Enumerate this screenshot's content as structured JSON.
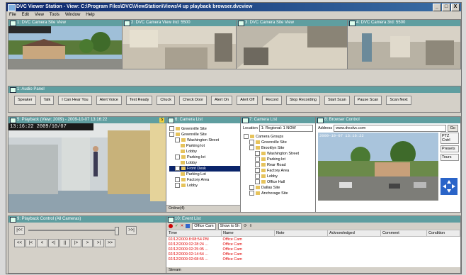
{
  "window": {
    "title": "DVC Viewer Station - View: C:\\Program Files\\DVC\\ViewStation\\Views\\4 up playback browser.dvcview",
    "controls": [
      "_",
      "□",
      "X"
    ]
  },
  "menu": [
    "File",
    "Edit",
    "View",
    "Tools",
    "Window",
    "Help"
  ],
  "cameras": [
    {
      "title": "1: DVC Camera Site View",
      "overlay": ""
    },
    {
      "title": "2: DVC Camera View Ind: 5500",
      "overlay": ""
    },
    {
      "title": "3: DVC Camera Site View",
      "overlay": ""
    },
    {
      "title": "4: DVC Camera 3rd: 5500",
      "overlay": ""
    }
  ],
  "audio_panel": {
    "title": "1: Audio Panel",
    "buttons": [
      "Speaker",
      "Talk",
      "I Can Hear You",
      "Alert Voice",
      "Text Ready",
      "Chuck",
      "Check Door",
      "Alert On",
      "Alert Off",
      "Record",
      "Stop Recording",
      "Start Scan",
      "Pause Scan",
      "Scan Next"
    ]
  },
  "playback_view": {
    "title": "5: Playback (View: 2009) - 2009-10-07 13:16:22",
    "overlay": "13:16:22 2009/10/07",
    "badge": "S"
  },
  "camera_list": {
    "title": "6: Camera List",
    "items": [
      {
        "label": "Greenville Site",
        "level": 0
      },
      {
        "label": "Greenville Site",
        "level": 0
      },
      {
        "label": "Washington Street",
        "level": 1
      },
      {
        "label": "Parking lot",
        "level": 2
      },
      {
        "label": "Lobby",
        "level": 2
      },
      {
        "label": "Parking lot",
        "level": 1
      },
      {
        "label": "Lobby",
        "level": 2
      },
      {
        "label": "Front Desk",
        "level": 1
      },
      {
        "label": "Parking Lot",
        "level": 2
      },
      {
        "label": "Factory Area",
        "level": 1
      },
      {
        "label": "Lobby",
        "level": 1
      }
    ],
    "status": "Online(4)"
  },
  "camera_tree": {
    "title": "7: Camera List",
    "location_label": "Location",
    "location_value": "1: Regional: 1 NOW",
    "items": [
      {
        "label": "Camera Groups",
        "level": 0
      },
      {
        "label": "Greenville Site",
        "level": 1
      },
      {
        "label": "Brooklyn Site",
        "level": 1
      },
      {
        "label": "Washington Street",
        "level": 2
      },
      {
        "label": "Parking lot",
        "level": 2
      },
      {
        "label": "Rear Road",
        "level": 2
      },
      {
        "label": "Factory Area",
        "level": 2
      },
      {
        "label": "Lobby",
        "level": 2
      },
      {
        "label": "Office Hall",
        "level": 2
      },
      {
        "label": "Dallas Site",
        "level": 1
      },
      {
        "label": "Anchorage Site",
        "level": 1
      }
    ]
  },
  "browser": {
    "title": "8: Browser Control",
    "address_label": "Address",
    "address_value": "www.dvcdvc.com",
    "go_label": "Go",
    "image_caption": "2009-10-07 13:16:22",
    "side_labels": [
      "PTZ Cntrl",
      "Presets",
      "Tours"
    ]
  },
  "playback_controls": {
    "title": "9: Playback Control (All Cameras)",
    "buttons": [
      "|<<",
      "<<",
      "|<",
      "<",
      "<|",
      "||",
      "|>",
      ">",
      ">|",
      ">>",
      ">>|"
    ]
  },
  "event_list": {
    "title": "10: Event List",
    "filter1": "Office Cam",
    "filter2": "Show to 5h",
    "columns": [
      "Time",
      "Name",
      "Note",
      "Acknowledged",
      "Comment",
      "Condition"
    ],
    "rows": [
      {
        "time": "02/12/2009 8:08:54 PM",
        "name": "Office Cam"
      },
      {
        "time": "02/12/2009 02:28:24 ...",
        "name": "Office Cam"
      },
      {
        "time": "02/12/2009 02:25:05 ...",
        "name": "Office Cam"
      },
      {
        "time": "02/12/2009 02:14:54 ...",
        "name": "Office Cam"
      },
      {
        "time": "02/12/2009 02:08:55 ...",
        "name": "Office Cam"
      }
    ],
    "status": "Stream"
  }
}
